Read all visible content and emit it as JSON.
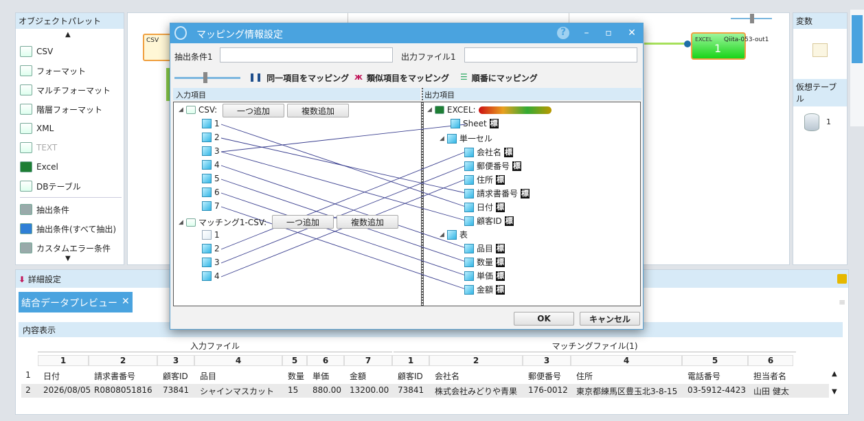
{
  "palette": {
    "title": "オブジェクトパレット",
    "items": [
      {
        "label": "CSV",
        "icon": "csv-icon"
      },
      {
        "label": "フォーマット",
        "icon": "format-icon"
      },
      {
        "label": "マルチフォーマット",
        "icon": "multi-format-icon"
      },
      {
        "label": "階層フォーマット",
        "icon": "hierarchy-format-icon"
      },
      {
        "label": "XML",
        "icon": "xml-icon"
      },
      {
        "label": "TEXT",
        "icon": "text-icon"
      },
      {
        "label": "Excel",
        "icon": "excel-icon"
      },
      {
        "label": "DBテーブル",
        "icon": "db-table-icon"
      },
      {
        "label": "抽出条件",
        "icon": "extract-condition-icon"
      },
      {
        "label": "抽出条件(すべて抽出)",
        "icon": "extract-all-icon"
      },
      {
        "label": "カスタムエラー条件",
        "icon": "custom-error-icon"
      }
    ]
  },
  "canvas": {
    "csv_node": "CSV",
    "excel_node_type": "EXCEL",
    "excel_node_name": "Qiita-053-out1",
    "excel_node_count": "1"
  },
  "right": {
    "variables": "変数",
    "virtual_table": "仮想テーブル",
    "vt_count": "1"
  },
  "detail": {
    "title": "詳細設定",
    "tab": "結合データプレビュー",
    "section": "内容表示",
    "group_input": "入力ファイル",
    "group_matching": "マッチングファイル(1)",
    "colnums": [
      "1",
      "2",
      "3",
      "4",
      "5",
      "6",
      "7",
      "1",
      "2",
      "3",
      "4",
      "5",
      "6"
    ],
    "header": [
      "日付",
      "請求書番号",
      "顧客ID",
      "品目",
      "数量",
      "単価",
      "金額",
      "顧客ID",
      "会社名",
      "郵便番号",
      "住所",
      "電話番号",
      "担当者名"
    ],
    "row": [
      "2026/08/05",
      "R0808051816",
      "73841",
      "シャインマスカット",
      "15",
      "880.00",
      "13200.00",
      "73841",
      "株式会社みどりや青果",
      "176-0012",
      "東京都練馬区豊玉北3-8-15",
      "03-5912-4423",
      "山田 健太"
    ],
    "rownums": [
      "1",
      "2"
    ]
  },
  "dialog": {
    "title": "マッピング情報設定",
    "cond_label": "抽出条件1",
    "cond_value": "",
    "out_label": "出力ファイル1",
    "out_value": "",
    "btn_same": "同一項目をマッピング",
    "btn_similar": "類似項目をマッピング",
    "btn_order": "順番にマッピング",
    "input_header": "入力項目",
    "output_header": "出力項目",
    "csv_label": "CSV:",
    "add_one": "一つ追加",
    "add_multi": "複数追加",
    "matching_label": "マッチング1-CSV:",
    "csv_fields": [
      "1",
      "2",
      "3",
      "4",
      "5",
      "6",
      "7"
    ],
    "match_fields": [
      "1",
      "2",
      "3",
      "4"
    ],
    "excel_label": "EXCEL:",
    "sheet": "Sheet",
    "single_cell": "単一セル",
    "cell_fields": [
      "会社名",
      "郵便番号",
      "住所",
      "請求書番号",
      "日付",
      "顧客ID"
    ],
    "table": "表",
    "table_fields": [
      "品目",
      "数量",
      "単価",
      "金額"
    ],
    "tag": "標",
    "ok": "OK",
    "cancel": "キャンセル"
  },
  "colors": {
    "accent": "#4aa3df",
    "line": "#3a3f8f",
    "excel_green": "#2edb2e"
  }
}
